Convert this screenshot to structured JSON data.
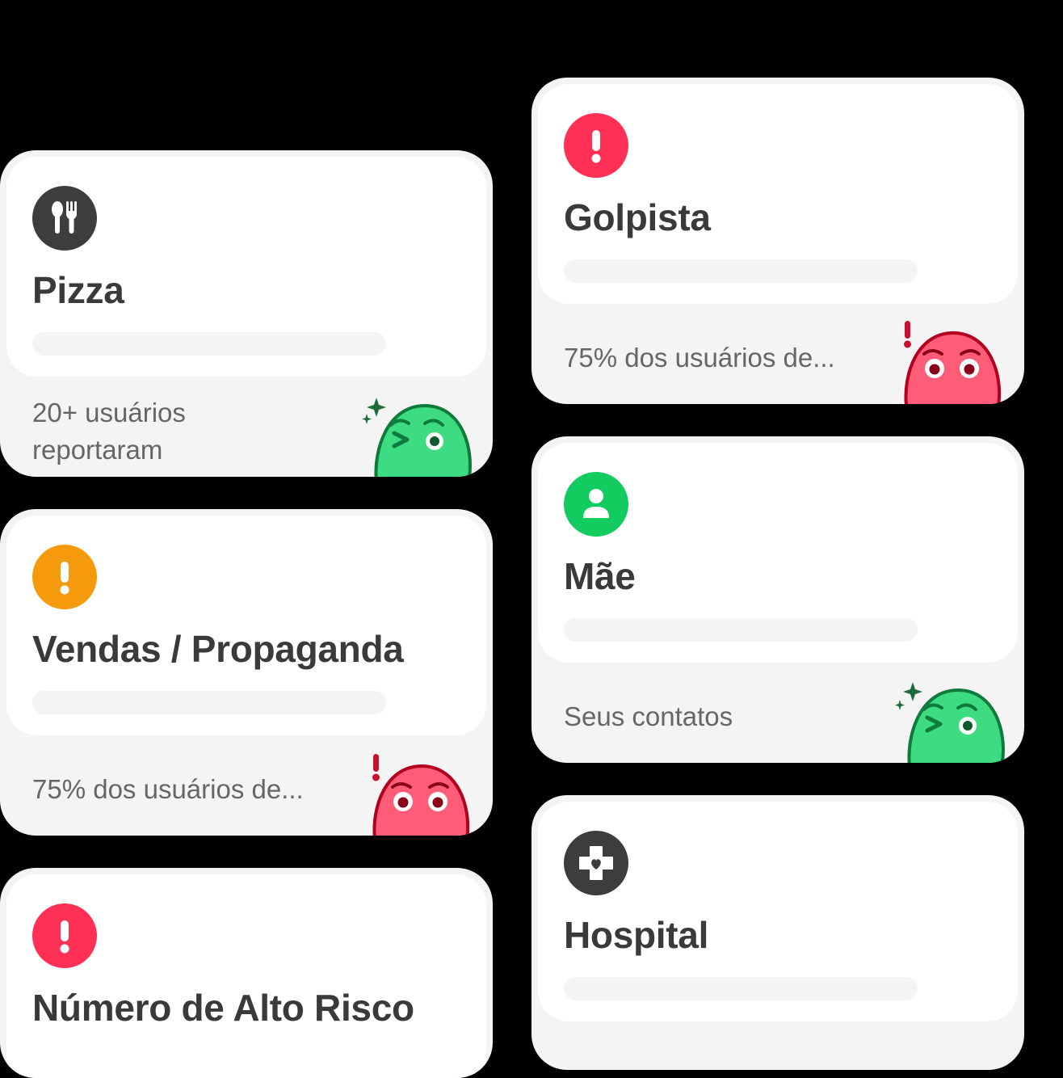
{
  "cards": [
    {
      "title": "Pizza",
      "footer_lines": [
        "20+ usuários",
        "reportaram"
      ],
      "icon": "fork-knife-icon",
      "icon_color": "#3d3d3d",
      "status": "safe"
    },
    {
      "title": "Golpista",
      "footer_lines": [
        "75% dos usuários de..."
      ],
      "icon": "exclamation-icon",
      "icon_color": "#ff2f55",
      "status": "danger"
    },
    {
      "title": "Vendas / Propaganda",
      "footer_lines": [
        "75% dos usuários de..."
      ],
      "icon": "exclamation-icon",
      "icon_color": "#f59a0c",
      "status": "danger"
    },
    {
      "title": "Mãe",
      "footer_lines": [
        "Seus contatos"
      ],
      "icon": "person-icon",
      "icon_color": "#12cc60",
      "status": "safe"
    },
    {
      "title": "Número de Alto Risco",
      "footer_lines": [],
      "icon": "exclamation-icon",
      "icon_color": "#ff2f55",
      "status": "danger"
    },
    {
      "title": "Hospital",
      "footer_lines": [],
      "icon": "medical-cross-icon",
      "icon_color": "#3d3d3d",
      "status": "safe"
    }
  ],
  "colors": {
    "background": "#000000",
    "card_bg": "#f4f4f4",
    "card_top": "#ffffff",
    "safe_face": "#35d677",
    "danger_face": "#ff4d6a"
  }
}
